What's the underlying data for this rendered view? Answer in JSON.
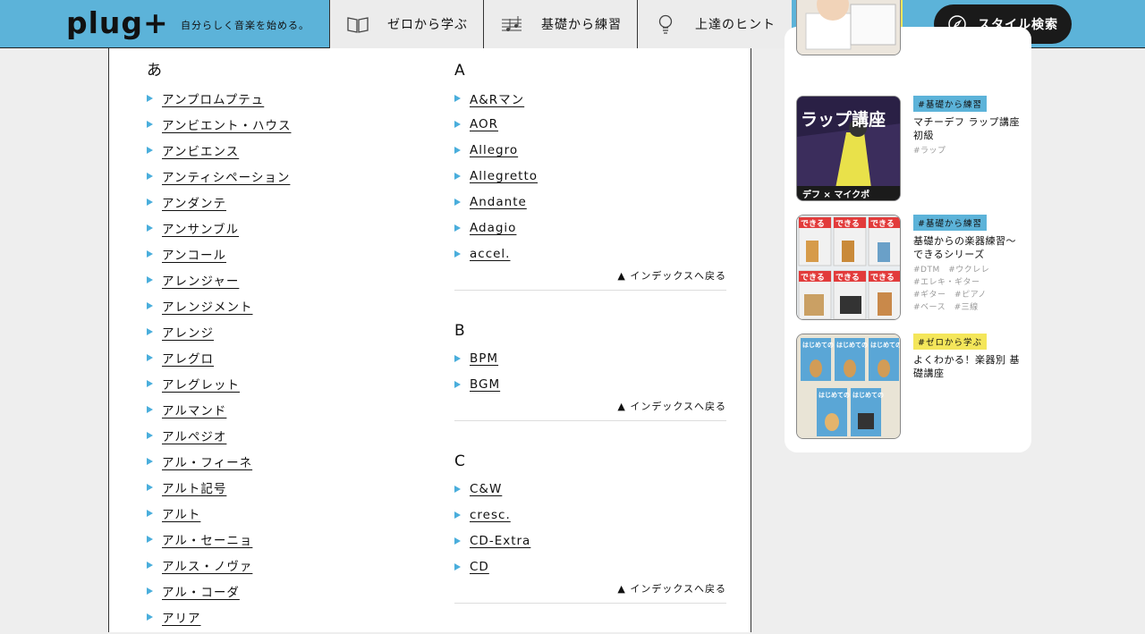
{
  "header": {
    "logo": "plug+",
    "tagline": "自分らしく音楽を始める。",
    "nav": [
      {
        "label": "ゼロから学ぶ",
        "icon": "book-icon"
      },
      {
        "label": "基礎から練習",
        "icon": "sheet-music-icon"
      },
      {
        "label": "上達のヒント",
        "icon": "lightbulb-icon"
      }
    ],
    "icon_buttons": [
      "video-player-icon",
      "zoom-in-window-icon"
    ],
    "style_search_label": "スタイル検索",
    "colors": {
      "header_bg": "#5cb3d9",
      "nav_bg": "#ececec",
      "icon_btn_bg": "#f4e65a",
      "search_bg": "#1a1a1a"
    }
  },
  "glossary": {
    "back_label": "▲ インデックスへ戻る",
    "left": {
      "heading": "あ",
      "terms": [
        "アンプロムプテュ",
        "アンビエント・ハウス",
        "アンビエンス",
        "アンティシペーション",
        "アンダンテ",
        "アンサンブル",
        "アンコール",
        "アレンジャー",
        "アレンジメント",
        "アレンジ",
        "アレグロ",
        "アレグレット",
        "アルマンド",
        "アルペジオ",
        "アル・フィーネ",
        "アルト記号",
        "アルト",
        "アル・セーニョ",
        "アルス・ノヴァ",
        "アル・コーダ",
        "アリア"
      ]
    },
    "right": [
      {
        "heading": "A",
        "terms": [
          "A&Rマン",
          "AOR",
          "Allegro",
          "Allegretto",
          "Andante",
          "Adagio",
          "accel."
        ]
      },
      {
        "heading": "B",
        "terms": [
          "BPM",
          "BGM"
        ]
      },
      {
        "heading": "C",
        "terms": [
          "C&W",
          "cresc.",
          "CD-Extra",
          "CD"
        ]
      }
    ],
    "accent_color": "#4aaedc"
  },
  "sidebar": {
    "cards": [
      {
        "tag": "#基礎から練習",
        "tag_color": "#5cb3d9",
        "title": "マチーデフ ラップ講座 初級",
        "subtags": [
          "#ラップ"
        ],
        "thumb_text": "ラップ講座",
        "thumb_sub": "デフ × マイクポ"
      },
      {
        "tag": "#基礎から練習",
        "tag_color": "#5cb3d9",
        "title": "基礎からの楽器練習～できるシリーズ",
        "subtags": [
          "#DTM　#ウクレレ",
          "#エレキ・ギター",
          "#ギター　#ピアノ",
          "#ベース　#三線"
        ],
        "thumb_text": "できる"
      },
      {
        "tag": "#ゼロから学ぶ",
        "tag_color": "#f4e65a",
        "title": "よくわかる！楽器別 基礎講座",
        "subtags": [],
        "thumb_text": "はじめての"
      }
    ]
  }
}
